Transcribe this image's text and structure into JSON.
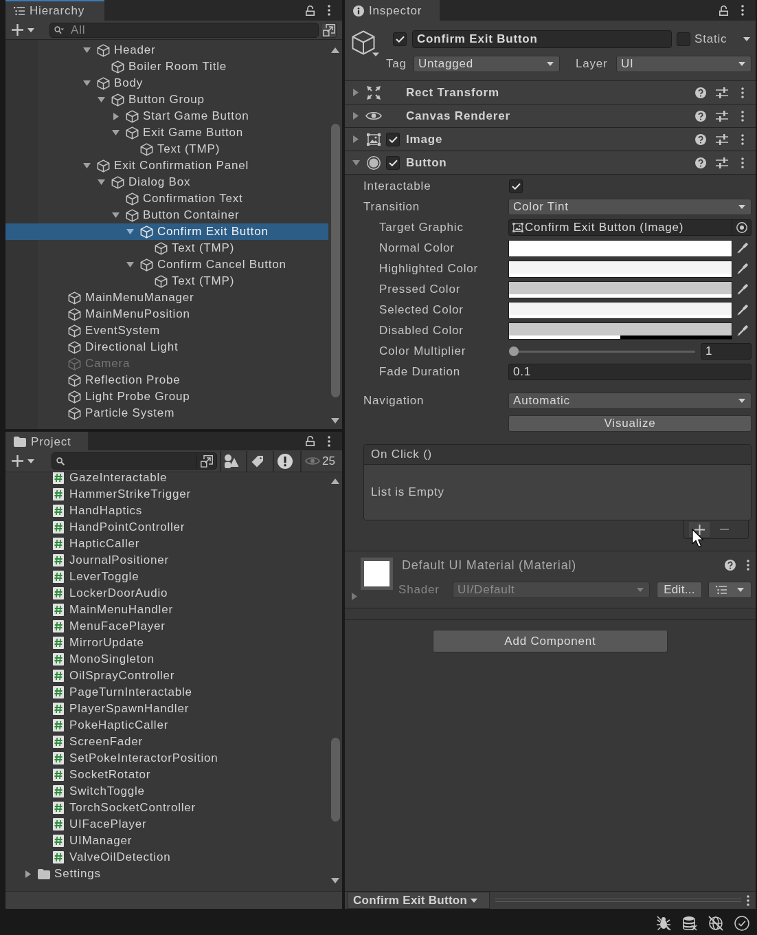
{
  "hierarchy": {
    "tab": {
      "label": "Hierarchy",
      "focused": true
    },
    "search": {
      "placeholder": "All"
    },
    "tree": [
      {
        "children": [
          {
            "children": [
              {
                "name": "Header",
                "expanded": true,
                "selected": false,
                "disabled": false,
                "children": [
                  {
                    "name": "Boiler Room Title",
                    "selected": false,
                    "disabled": false
                  }
                ]
              },
              {
                "name": "Body",
                "expanded": true,
                "selected": false,
                "disabled": false,
                "children": [
                  {
                    "name": "Button Group",
                    "expanded": true,
                    "selected": false,
                    "disabled": false,
                    "children": [
                      {
                        "name": "Start Game Button",
                        "expanded": false,
                        "selected": false,
                        "disabled": false
                      },
                      {
                        "name": "Exit Game Button",
                        "expanded": true,
                        "selected": false,
                        "disabled": false,
                        "children": [
                          {
                            "name": "Text (TMP)",
                            "selected": false,
                            "disabled": false
                          }
                        ]
                      }
                    ]
                  }
                ]
              },
              {
                "name": "Exit Confirmation Panel",
                "expanded": true,
                "selected": false,
                "disabled": false,
                "children": [
                  {
                    "name": "Dialog Box",
                    "expanded": true,
                    "selected": false,
                    "disabled": false,
                    "children": [
                      {
                        "name": "Confirmation Text",
                        "selected": false,
                        "disabled": false
                      },
                      {
                        "name": "Button Container",
                        "expanded": true,
                        "selected": false,
                        "disabled": false,
                        "children": [
                          {
                            "name": "Confirm Exit Button",
                            "expanded": true,
                            "selected": true,
                            "disabled": false,
                            "children": [
                              {
                                "name": "Text (TMP)",
                                "selected": false,
                                "disabled": false
                              }
                            ]
                          },
                          {
                            "name": "Confirm Cancel Button",
                            "expanded": true,
                            "selected": false,
                            "disabled": false,
                            "children": [
                              {
                                "name": "Text (TMP)",
                                "selected": false,
                                "disabled": false
                              }
                            ]
                          }
                        ]
                      }
                    ]
                  }
                ]
              }
            ]
          }
        ]
      },
      {
        "name": "MainMenuManager",
        "selected": false,
        "disabled": false
      },
      {
        "name": "MainMenuPosition",
        "selected": false,
        "disabled": false
      },
      {
        "name": "EventSystem",
        "selected": false,
        "disabled": false
      },
      {
        "name": "Directional Light",
        "selected": false,
        "disabled": false
      },
      {
        "name": "Camera",
        "selected": false,
        "disabled": true
      },
      {
        "name": "Reflection Probe",
        "selected": false,
        "disabled": false
      },
      {
        "name": "Light Probe Group",
        "selected": false,
        "disabled": false
      },
      {
        "name": "Particle System",
        "selected": false,
        "disabled": false
      }
    ]
  },
  "project": {
    "tab": {
      "label": "Project",
      "focused": false
    },
    "hidden_count": "25",
    "items": [
      {
        "children": [
          {
            "name": "GazeInteractable",
            "kind": "script",
            "selected": false
          },
          {
            "name": "HammerStrikeTrigger",
            "kind": "script",
            "selected": false
          },
          {
            "name": "HandHaptics",
            "kind": "script",
            "selected": false
          },
          {
            "name": "HandPointController",
            "kind": "script",
            "selected": false
          },
          {
            "name": "HapticCaller",
            "kind": "script",
            "selected": false
          },
          {
            "name": "JournalPositioner",
            "kind": "script",
            "selected": false
          },
          {
            "name": "LeverToggle",
            "kind": "script",
            "selected": false
          },
          {
            "name": "LockerDoorAudio",
            "kind": "script",
            "selected": false
          },
          {
            "name": "MainMenuHandler",
            "kind": "script",
            "selected": false
          },
          {
            "name": "MenuFacePlayer",
            "kind": "script",
            "selected": false
          },
          {
            "name": "MirrorUpdate",
            "kind": "script",
            "selected": false
          },
          {
            "name": "MonoSingleton",
            "kind": "script",
            "selected": false
          },
          {
            "name": "OilSprayController",
            "kind": "script",
            "selected": false
          },
          {
            "name": "PageTurnInteractable",
            "kind": "script",
            "selected": false
          },
          {
            "name": "PlayerSpawnHandler",
            "kind": "script",
            "selected": false
          },
          {
            "name": "PokeHapticCaller",
            "kind": "script",
            "selected": false
          },
          {
            "name": "ScreenFader",
            "kind": "script",
            "selected": false
          },
          {
            "name": "SetPokeInteractorPosition",
            "kind": "script",
            "selected": false
          },
          {
            "name": "SocketRotator",
            "kind": "script",
            "selected": false
          },
          {
            "name": "SwitchToggle",
            "kind": "script",
            "selected": false
          },
          {
            "name": "TorchSocketController",
            "kind": "script",
            "selected": false
          },
          {
            "name": "UIFacePlayer",
            "kind": "script",
            "selected": false
          },
          {
            "name": "UIManager",
            "kind": "script",
            "selected": false
          },
          {
            "name": "ValveOilDetection",
            "kind": "script",
            "selected": false
          }
        ]
      },
      {
        "name": "Settings",
        "kind": "folder",
        "expanded": false,
        "selected": false
      }
    ]
  },
  "inspector": {
    "tab": {
      "label": "Inspector",
      "focused": false
    },
    "object": {
      "active": true,
      "name": "Confirm Exit Button",
      "static": false,
      "static_label": "Static",
      "tag_label": "Tag",
      "tag": "Untagged",
      "layer_label": "Layer",
      "layer": "UI"
    },
    "components": [
      {
        "kind": "rect-transform",
        "title": "Rect Transform",
        "expanded": false
      },
      {
        "kind": "canvas-renderer",
        "title": "Canvas Renderer",
        "expanded": false
      },
      {
        "kind": "image",
        "title": "Image",
        "expanded": false,
        "enabled": true
      },
      {
        "kind": "button",
        "title": "Button",
        "expanded": true,
        "enabled": true,
        "properties": [
          {
            "kind": "checkbox",
            "label": "Interactable",
            "checked": true
          },
          {
            "kind": "dropdown",
            "label": "Transition",
            "value": "Color Tint",
            "children": [
              {
                "kind": "object",
                "label": "Target Graphic",
                "value": "Confirm Exit Button (Image)"
              },
              {
                "kind": "color",
                "label": "Normal Color",
                "color": "#ffffff",
                "level": 1
              },
              {
                "kind": "color",
                "label": "Highlighted Color",
                "color": "#f5f5f5",
                "level": 1
              },
              {
                "kind": "color",
                "label": "Pressed Color",
                "color": "#c8c8c8",
                "level": 1
              },
              {
                "kind": "color",
                "label": "Selected Color",
                "color": "#f5f5f5",
                "level": 1
              },
              {
                "kind": "color",
                "label": "Disabled Color",
                "color": "#c8c8c8",
                "level": 0.5
              },
              {
                "kind": "slider",
                "label": "Color Multiplier",
                "level": 0,
                "value": "1"
              },
              {
                "kind": "number",
                "label": "Fade Duration",
                "value": "0.1"
              }
            ]
          },
          {
            "kind": "dropdown",
            "label": "Navigation",
            "value": "Automatic"
          },
          {
            "kind": "button",
            "label": "Visualize"
          }
        ],
        "event": {
          "title": "On Click ()",
          "empty_text": "List is Empty"
        }
      }
    ],
    "material": {
      "title": "Default UI Material (Material)",
      "expanded": false,
      "shader_label": "Shader",
      "shader": "UI/Default",
      "edit_button": "Edit..."
    },
    "add_component": "Add Component",
    "footer": {
      "object": "Confirm Exit Button"
    }
  }
}
